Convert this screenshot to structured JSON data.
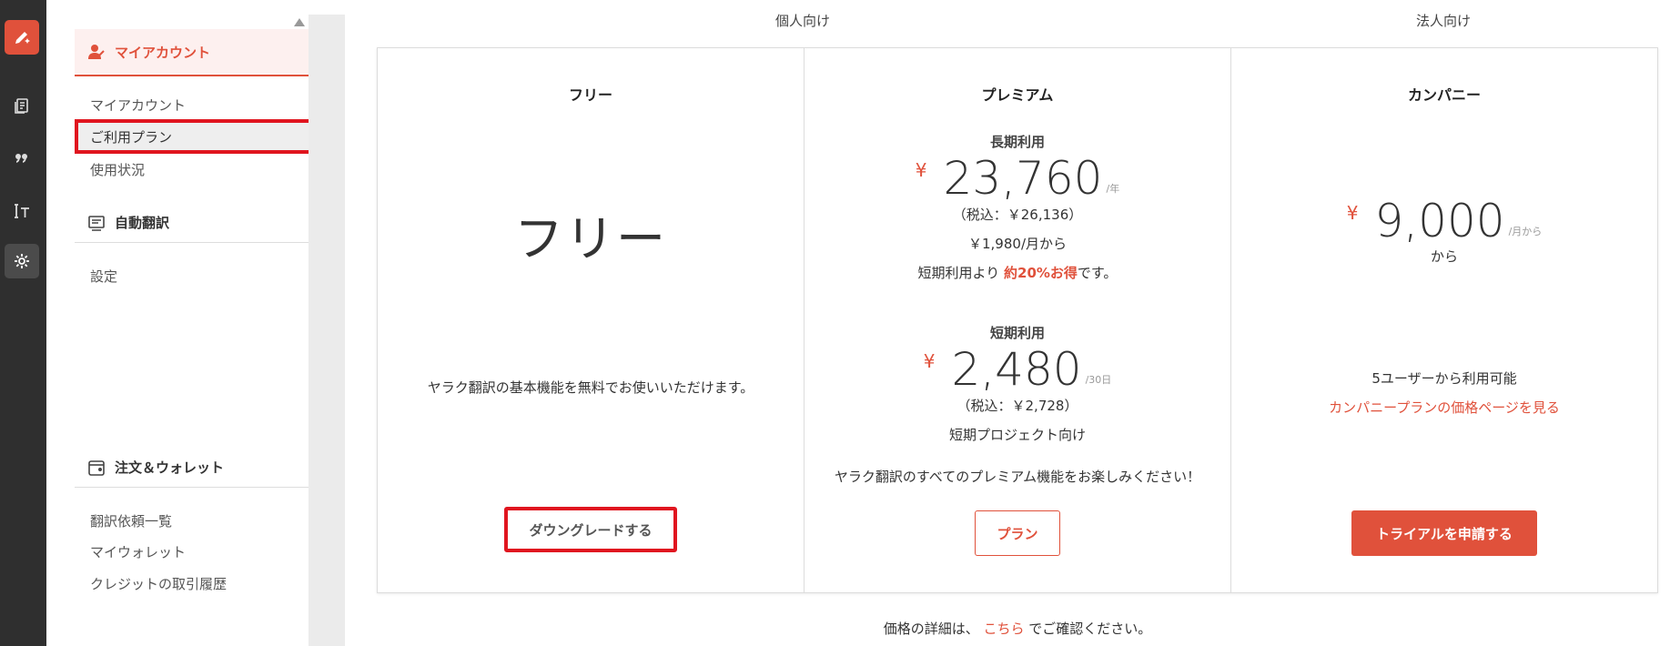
{
  "rail": {
    "icons": [
      "edit-icon",
      "document-icon",
      "quote-icon",
      "text-size-icon",
      "gear-icon"
    ]
  },
  "sidebar": {
    "header": "マイアカウント",
    "account_items": [
      "マイアカウント",
      "ご利用プラン",
      "使用状況"
    ],
    "auto_section": "自動翻訳",
    "auto_items": [
      "設定"
    ],
    "wallet_section": "注文＆ウォレット",
    "wallet_items": [
      "翻訳依頼一覧",
      "マイウォレット",
      "クレジットの取引履歴"
    ]
  },
  "columns": {
    "personal": "個人向け",
    "corporate": "法人向け"
  },
  "plans": {
    "free": {
      "title": "フリー",
      "big": "フリー",
      "desc": "ヤラク翻訳の基本機能を無料でお使いいただけます。",
      "button": "ダウングレードする"
    },
    "premium": {
      "title": "プレミアム",
      "long_label": "長期利用",
      "long_yen": "¥",
      "long_price": "23,760",
      "long_unit": "/年",
      "long_tax": "（税込：￥26,136）",
      "long_monthly": "￥1,980/月から",
      "long_save_prefix": "短期利用より ",
      "long_save_accent": "約20%お得",
      "long_save_suffix": "です。",
      "short_label": "短期利用",
      "short_yen": "¥",
      "short_price": "2,480",
      "short_unit": "/30日",
      "short_tax": "（税込：￥2,728）",
      "short_note": "短期プロジェクト向け",
      "desc": "ヤラク翻訳のすべてのプレミアム機能をお楽しみください！",
      "button": "プラン"
    },
    "company": {
      "title": "カンパニー",
      "yen": "¥",
      "price": "9,000",
      "unit": "/月から",
      "from": "から",
      "users": "5ユーザーから利用可能",
      "link": "カンパニープランの価格ページを見る",
      "button": "トライアルを申請する"
    }
  },
  "footer": {
    "prefix": "価格の詳細は、",
    "link": "こちら",
    "suffix": "でご確認ください。"
  },
  "colors": {
    "accent": "#e0513b",
    "highlight_box": "#e0151f",
    "rail_bg": "#2f2f2f"
  }
}
